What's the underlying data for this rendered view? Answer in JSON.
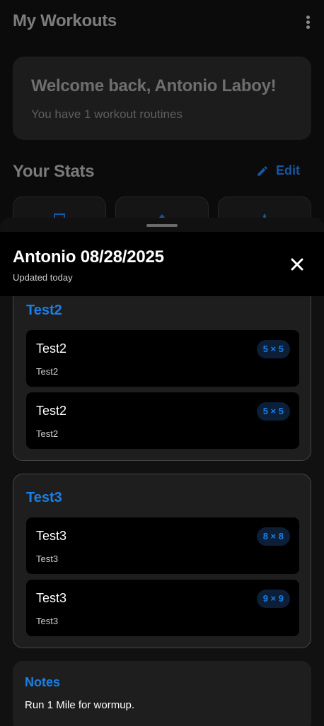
{
  "app": {
    "title": "My Workouts"
  },
  "welcome": {
    "title": "Welcome back, Antonio Laboy!",
    "subtitle": "You have 1 workout routines"
  },
  "stats": {
    "title": "Your Stats",
    "edit_label": "Edit"
  },
  "sheet": {
    "title": "Antonio 08/28/2025",
    "subtitle": "Updated today"
  },
  "routines": [
    {
      "name": "Test2",
      "exercises": [
        {
          "name": "Test2",
          "note": "Test2",
          "badge": "5 × 5"
        },
        {
          "name": "Test2",
          "note": "Test2",
          "badge": "5 × 5"
        }
      ]
    },
    {
      "name": "Test3",
      "exercises": [
        {
          "name": "Test3",
          "note": "Test3",
          "badge": "8 × 8"
        },
        {
          "name": "Test3",
          "note": "Test3",
          "badge": "9 × 9"
        }
      ]
    }
  ],
  "notes": {
    "title": "Notes",
    "text": "Run 1 Mile for wormup."
  },
  "colors": {
    "accent": "#1a7fe6",
    "background": "#000000",
    "card": "#1e1e1e"
  }
}
